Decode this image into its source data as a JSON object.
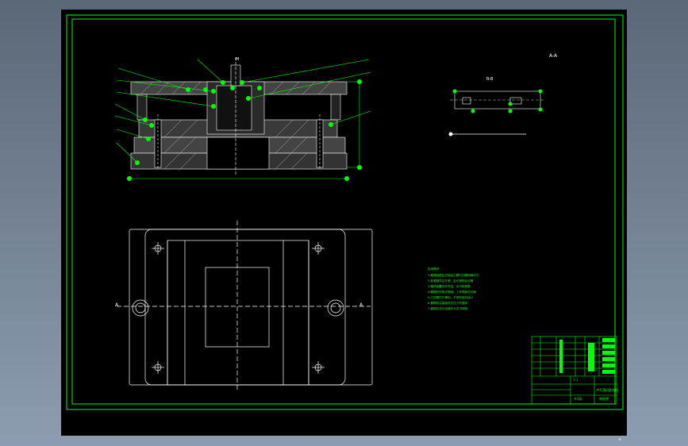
{
  "colors": {
    "background": "#000000",
    "border": "#00ff00",
    "geometry": "#ffffff",
    "notes": "#00ff00",
    "grip": "#00ff00",
    "title_block_fill": "#00ff00"
  },
  "section_view": {
    "top_label": "M"
  },
  "detail_view": {
    "label": "A-A",
    "small_label": "B-B"
  },
  "plan_view": {
    "section_marker_left": "A",
    "section_marker_right": "A"
  },
  "tech_notes": {
    "header": "技术要求",
    "lines": [
      "1.模具装配后应保证凸模与凹模间隙均匀",
      "2.各紧固件应拧紧，定位销配合可靠",
      "3.推件装置动作灵活，无卡阻现象",
      "4.模具外形棱边倒钝，工作表面无划痕",
      "5.凸凹模刃口锋利，不得有崩刃缺口",
      "6.模具闭合高度符合压力机要求",
      "7.装配后试冲合格方可交付使用"
    ]
  },
  "title_block": {
    "title": "冲孔落料复合模",
    "drawing_no": "装配图",
    "scale": "1:1",
    "sheet": "共1张"
  },
  "page_marker": "1"
}
